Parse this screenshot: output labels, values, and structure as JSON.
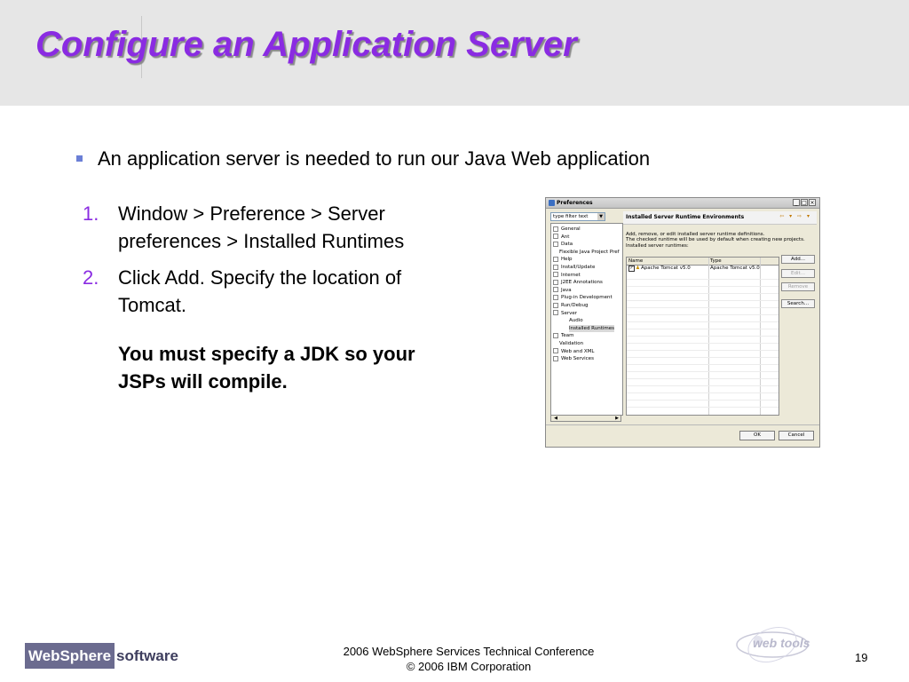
{
  "slide": {
    "title": "Configure an Application Server",
    "bullet": "An application server is needed to run our Java Web application",
    "steps": [
      {
        "num": "1.",
        "text": "Window > Preference > Server preferences > Installed Runtimes"
      },
      {
        "num": "2.",
        "text": "Click Add. Specify the location of Tomcat."
      }
    ],
    "note": "You must specify a JDK so your JSPs will compile."
  },
  "dialog": {
    "title": "Preferences",
    "filter_placeholder": "type filter text",
    "tree": [
      "General",
      "Ant",
      "Data",
      "Flexible Java Project Pref",
      "Help",
      "Install/Update",
      "Internet",
      "J2EE Annotations",
      "Java",
      "Plug-in Development",
      "Run/Debug",
      "Server",
      "Audio",
      "Installed Runtimes",
      "Team",
      "Validation",
      "Web and XML",
      "Web Services"
    ],
    "page_title": "Installed Server Runtime Environments",
    "desc1": "Add, remove, or edit installed server runtime definitions.",
    "desc2": "The checked runtime will be used by default when creating new projects.",
    "desc3": "Installed server runtimes:",
    "col_name": "Name",
    "col_type": "Type",
    "runtime_name": "Apache Tomcat v5.0",
    "runtime_type": "Apache Tomcat v5.0",
    "buttons": {
      "add": "Add...",
      "edit": "Edit...",
      "remove": "Remove",
      "search": "Search..."
    },
    "ok": "OK",
    "cancel": "Cancel"
  },
  "footer": {
    "logo_left": "WebSphere",
    "logo_right": "software",
    "line1": "2006 WebSphere Services Technical Conference",
    "line2": "© 2006 IBM Corporation",
    "webtools": "web tools",
    "page": "19"
  }
}
